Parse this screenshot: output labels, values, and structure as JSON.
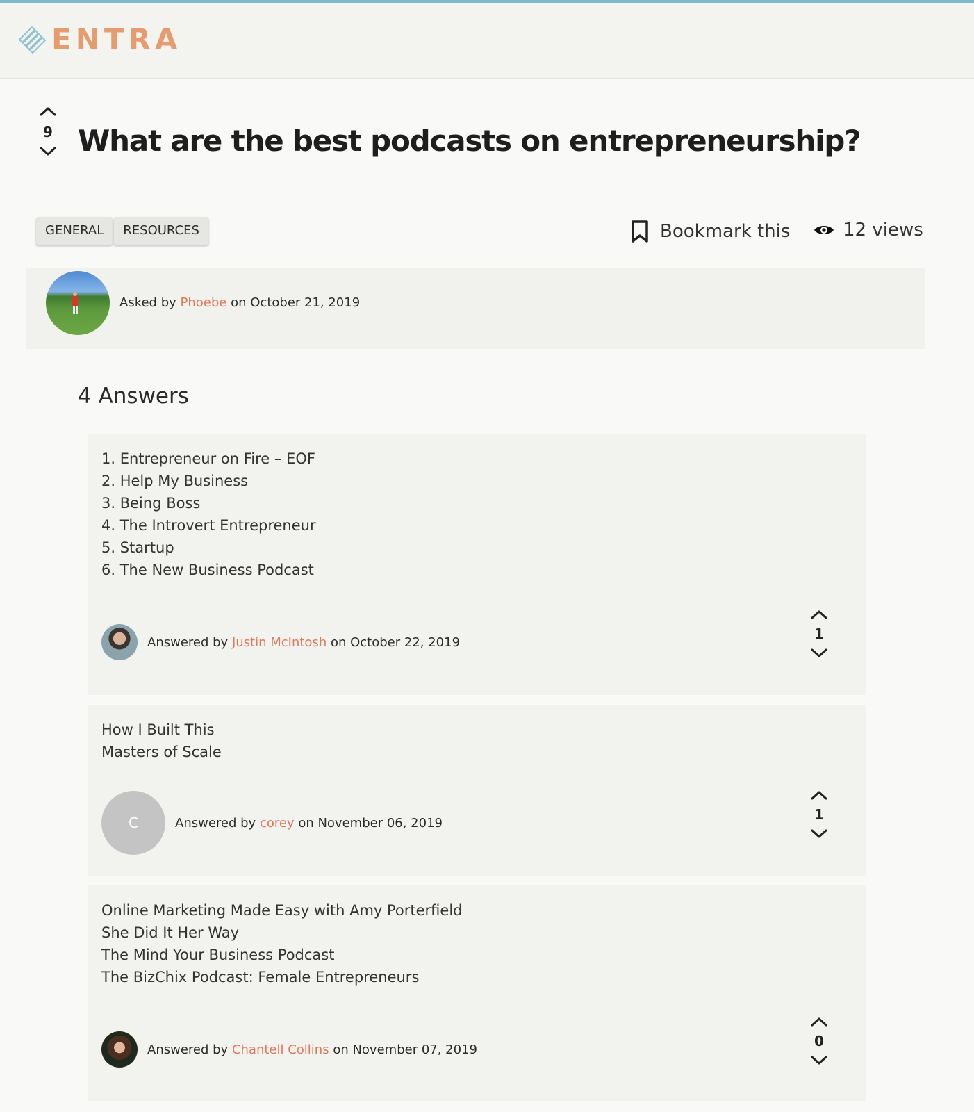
{
  "brand": {
    "name": "ENTRA",
    "color": "#e59c6f",
    "accent": "#7fb8c6"
  },
  "question": {
    "title": "What are the best podcasts on entrepreneurship?",
    "votes": "9",
    "tags": [
      "GENERAL",
      "RESOURCES"
    ],
    "bookmark_label": "Bookmark this",
    "views_label": "12 views",
    "asked_prefix": "Asked by",
    "author": "Phoebe",
    "date_text": "on October 21, 2019"
  },
  "answers_title": "4 Answers",
  "answers": [
    {
      "lines": [
        "1. Entrepreneur on Fire – EOF",
        "2. Help My Business",
        "3. Being Boss",
        "4. The Introvert Entrepreneur",
        "5. Startup",
        "6. The New Business Podcast"
      ],
      "prefix": "Answered by",
      "author": "Justin McIntosh",
      "date_text": "on October 22, 2019",
      "votes": "1",
      "avatar": "photo"
    },
    {
      "lines": [
        "How I Built This",
        "Masters of Scale"
      ],
      "prefix": "Answered by",
      "author": "corey",
      "date_text": "on November 06, 2019",
      "votes": "1",
      "avatar_letter": "C"
    },
    {
      "lines": [
        "Online Marketing Made Easy with Amy Porterfield",
        "She Did It Her Way",
        "The Mind Your Business Podcast",
        "The BizChix Podcast: Female Entrepreneurs"
      ],
      "prefix": "Answered by",
      "author": "Chantell Collins",
      "date_text": "on November 07, 2019",
      "votes": "0",
      "avatar": "photo"
    }
  ],
  "icons": {
    "upvote": "chevron-up-icon",
    "downvote": "chevron-down-icon",
    "bookmark": "bookmark-icon",
    "views": "eye-icon"
  },
  "colors": {
    "link": "#e0795a",
    "panel": "#f2f2ee",
    "background": "#f9f9f8"
  }
}
